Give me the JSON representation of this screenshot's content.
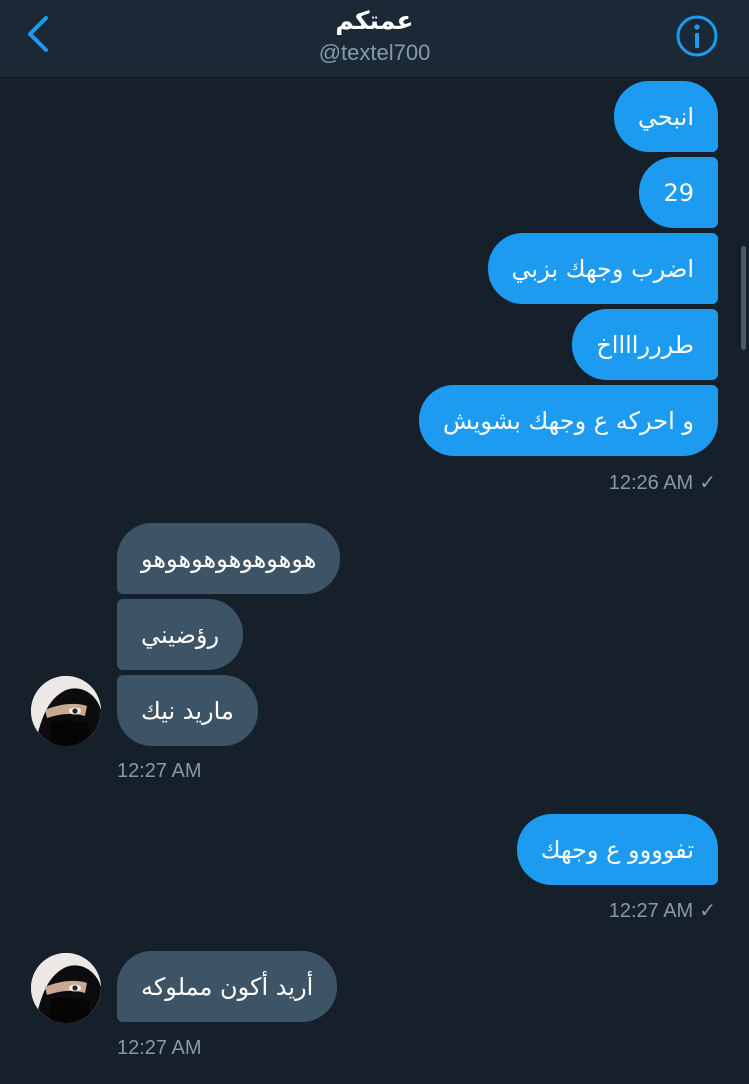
{
  "header": {
    "title": "عمتكم",
    "handle": "@textel700"
  },
  "messages": {
    "sent_group_1": [
      "انبحي",
      "29",
      "اضرب وجهك بزبي",
      "طرررااااخ",
      "و احركه ع وجهك بشويش"
    ],
    "sent_group_1_time": "12:26 AM",
    "recv_group_1": [
      "هوهوهوهوهوهوهو",
      "رؤضيني",
      "ماريد نيك"
    ],
    "recv_group_1_time": "12:27 AM",
    "sent_group_2": [
      "تفوووو ع وجهك"
    ],
    "sent_group_2_time": "12:27 AM",
    "recv_group_2": [
      "أريد أكون مملوكه"
    ],
    "recv_group_2_time": "12:27 AM"
  },
  "icons": {
    "back": "chevron-left-icon",
    "info": "info-icon",
    "read_check": "✓"
  },
  "colors": {
    "background": "#15202b",
    "header": "#1b2836",
    "sent_bubble": "#1d9bf0",
    "received_bubble": "#3d5466",
    "muted_text": "#8899a6"
  }
}
